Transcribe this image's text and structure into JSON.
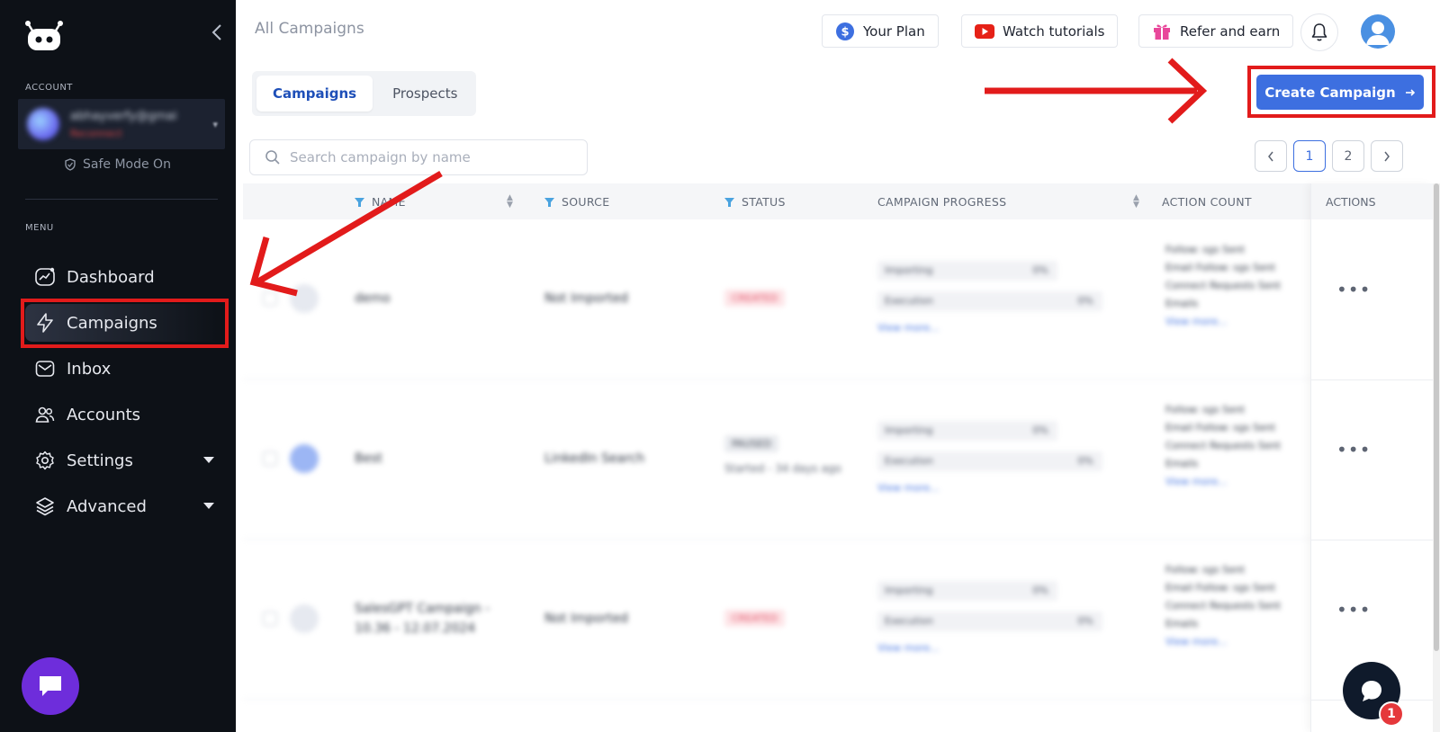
{
  "sidebar": {
    "account_label": "ACCOUNT",
    "account_name": "abhayverfy@gmai",
    "account_status": "Reconnect",
    "safe_mode": "Safe Mode On",
    "menu_label": "MENU",
    "items": [
      {
        "label": "Dashboard",
        "icon": "dashboard-icon"
      },
      {
        "label": "Campaigns",
        "icon": "lightning-icon",
        "active": true
      },
      {
        "label": "Inbox",
        "icon": "mail-icon"
      },
      {
        "label": "Accounts",
        "icon": "users-icon"
      },
      {
        "label": "Settings",
        "icon": "gear-icon",
        "expandable": true
      },
      {
        "label": "Advanced",
        "icon": "layers-icon",
        "expandable": true
      }
    ]
  },
  "header": {
    "title": "All Campaigns",
    "your_plan": "Your Plan",
    "watch_tutorials": "Watch tutorials",
    "refer_and_earn": "Refer and earn"
  },
  "tabs": [
    {
      "label": "Campaigns",
      "active": true
    },
    {
      "label": "Prospects",
      "active": false
    }
  ],
  "create_button": "Create Campaign",
  "search": {
    "placeholder": "Search campaign by name"
  },
  "pagination": {
    "pages": [
      "1",
      "2"
    ],
    "current": "1"
  },
  "table": {
    "columns": [
      "NAME",
      "SOURCE",
      "STATUS",
      "CAMPAIGN PROGRESS",
      "ACTION COUNT",
      "ACTIONS"
    ],
    "rows": [
      {
        "name": "demo",
        "source": "Not Imported",
        "status": "CREATED",
        "status_sub": "",
        "progress": [
          {
            "label": "Importing",
            "value": "0%"
          },
          {
            "label": "Execution",
            "value": "0%"
          }
        ],
        "view_more": "View more...",
        "actions": [
          "Follow: sgs Sent",
          "Email Follow: sgs Sent",
          "Connect Requests Sent Emails",
          "View more..."
        ]
      },
      {
        "name": "Best",
        "source": "LinkedIn Search",
        "status": "PAUSED",
        "status_sub": "Started - 34 days ago",
        "progress": [
          {
            "label": "Importing",
            "value": "0%"
          },
          {
            "label": "Execution",
            "value": "0%"
          }
        ],
        "view_more": "View more...",
        "actions": [
          "Follow: sgs Sent",
          "Email Follow: sgs Sent",
          "Connect Requests Sent Emails",
          "View more..."
        ]
      },
      {
        "name": "SalesGPT Campaign - 10.36 - 12.07.2024",
        "source": "Not Imported",
        "status": "CREATED",
        "status_sub": "",
        "progress": [
          {
            "label": "Importing",
            "value": "0%"
          },
          {
            "label": "Execution",
            "value": "0%"
          }
        ],
        "view_more": "View more...",
        "actions": [
          "Follow: sgs Sent",
          "Email Follow: sgs Sent",
          "Connect Requests Sent Emails",
          "View more..."
        ]
      }
    ]
  },
  "help_badge": "1",
  "colors": {
    "sidebar_bg": "#0d1117",
    "accent": "#3d6fe0",
    "highlight_red": "#e21b1b",
    "chat_purple": "#6e2ddb"
  }
}
